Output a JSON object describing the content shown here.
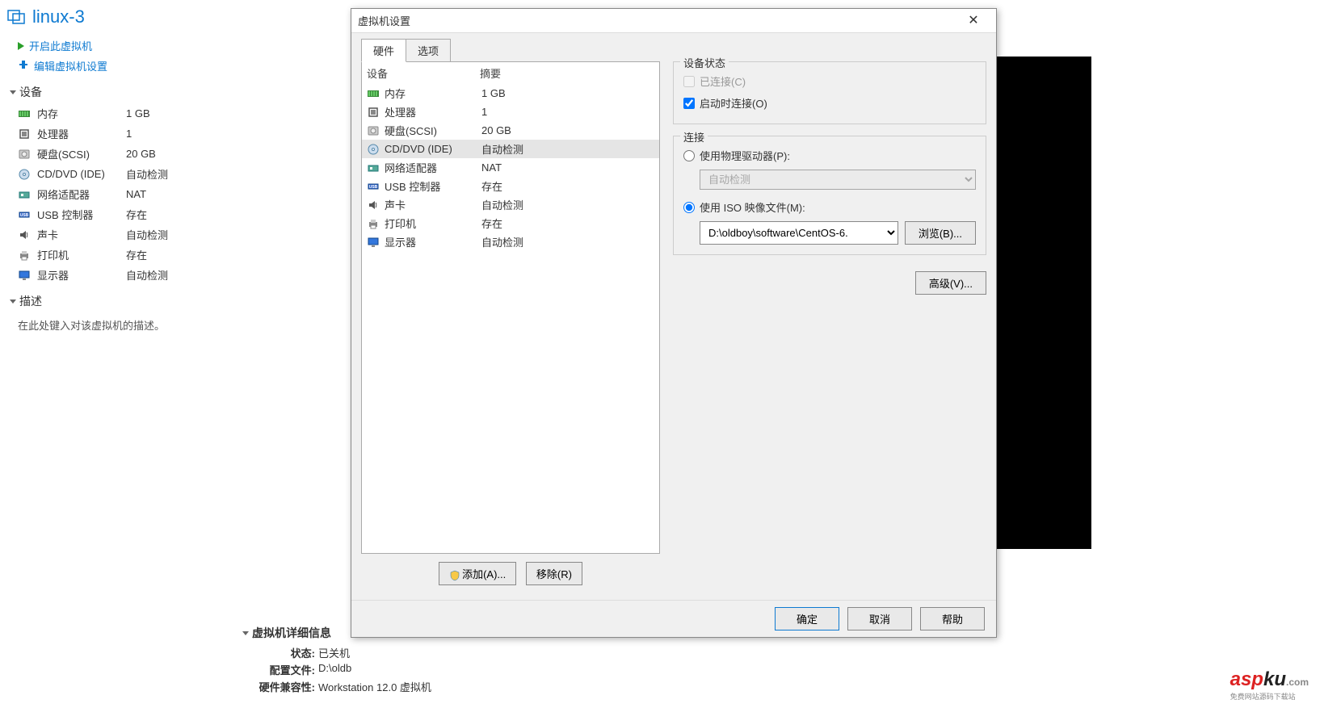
{
  "vm": {
    "name": "linux-3",
    "actions": {
      "power_on": "开启此虚拟机",
      "edit_settings": "编辑虚拟机设置"
    }
  },
  "left_sections": {
    "devices_header": "设备",
    "description_header": "描述",
    "description_placeholder": "在此处键入对该虚拟机的描述。"
  },
  "left_devices": [
    {
      "name": "内存",
      "value": "1 GB",
      "icon": "memory"
    },
    {
      "name": "处理器",
      "value": "1",
      "icon": "cpu"
    },
    {
      "name": "硬盘(SCSI)",
      "value": "20 GB",
      "icon": "hdd"
    },
    {
      "name": "CD/DVD (IDE)",
      "value": "自动检测",
      "icon": "cd"
    },
    {
      "name": "网络适配器",
      "value": "NAT",
      "icon": "nic"
    },
    {
      "name": "USB 控制器",
      "value": "存在",
      "icon": "usb"
    },
    {
      "name": "声卡",
      "value": "自动检测",
      "icon": "sound"
    },
    {
      "name": "打印机",
      "value": "存在",
      "icon": "printer"
    },
    {
      "name": "显示器",
      "value": "自动检测",
      "icon": "display"
    }
  ],
  "vm_details": {
    "header": "虚拟机详细信息",
    "rows": [
      {
        "k": "状态:",
        "v": "已关机"
      },
      {
        "k": "配置文件:",
        "v": "D:\\oldb"
      },
      {
        "k": "硬件兼容性:",
        "v": "Workstation 12.0 虚拟机"
      }
    ]
  },
  "dialog": {
    "title": "虚拟机设置",
    "tabs": {
      "hardware": "硬件",
      "options": "选项"
    },
    "columns": {
      "device": "设备",
      "summary": "摘要"
    },
    "devices": [
      {
        "name": "内存",
        "summary": "1 GB",
        "icon": "memory"
      },
      {
        "name": "处理器",
        "summary": "1",
        "icon": "cpu"
      },
      {
        "name": "硬盘(SCSI)",
        "summary": "20 GB",
        "icon": "hdd"
      },
      {
        "name": "CD/DVD (IDE)",
        "summary": "自动检测",
        "icon": "cd",
        "selected": true
      },
      {
        "name": "网络适配器",
        "summary": "NAT",
        "icon": "nic"
      },
      {
        "name": "USB 控制器",
        "summary": "存在",
        "icon": "usb"
      },
      {
        "name": "声卡",
        "summary": "自动检测",
        "icon": "sound"
      },
      {
        "name": "打印机",
        "summary": "存在",
        "icon": "printer"
      },
      {
        "name": "显示器",
        "summary": "自动检测",
        "icon": "display"
      }
    ],
    "add_btn": "添加(A)...",
    "remove_btn": "移除(R)",
    "device_status": {
      "group": "设备状态",
      "connected": "已连接(C)",
      "connect_at_power_on": "启动时连接(O)"
    },
    "connection": {
      "group": "连接",
      "physical_drive": "使用物理驱动器(P):",
      "physical_drive_value": "自动检测",
      "iso_file": "使用 ISO 映像文件(M):",
      "iso_value": "D:\\oldboy\\software\\CentOS-6.",
      "browse": "浏览(B)..."
    },
    "advanced": "高级(V)...",
    "ok": "确定",
    "cancel": "取消",
    "help": "帮助"
  },
  "watermark": {
    "brand_red": "asp",
    "brand_black": "ku",
    "suffix": ".com",
    "tagline": "免费网站源码下载站"
  }
}
